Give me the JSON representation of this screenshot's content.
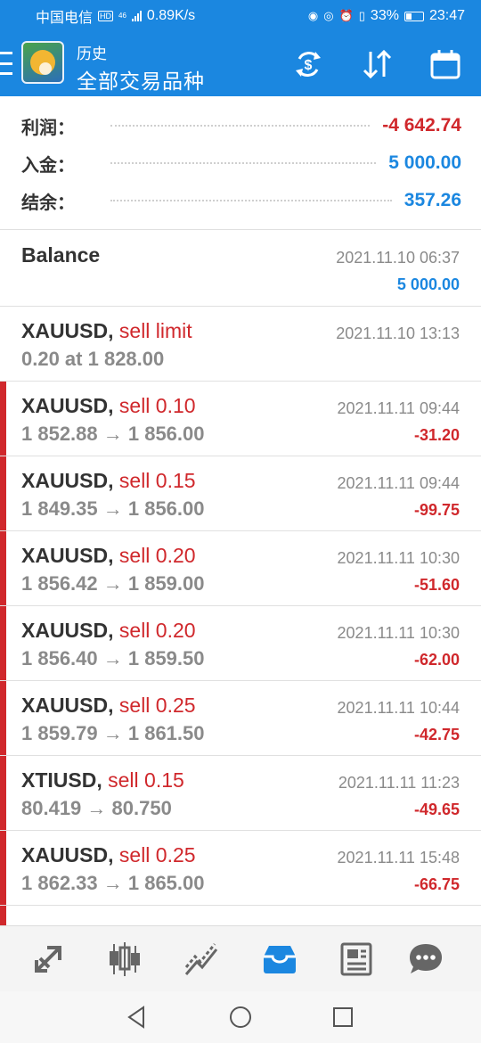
{
  "status_bar": {
    "carrier": "中国电信",
    "net_badge": "HD",
    "signal_label": "46",
    "speed": "0.89K/s",
    "battery": "33%",
    "time": "23:47"
  },
  "header": {
    "subtitle": "历史",
    "title": "全部交易品种",
    "icons": [
      "menu-icon",
      "app-logo",
      "currency-exchange-icon",
      "sort-icon",
      "calendar-icon"
    ]
  },
  "summary": {
    "profit_label": "利润：",
    "profit_value": "-4 642.74",
    "deposit_label": "入金：",
    "deposit_value": "5 000.00",
    "balance_label": "结余：",
    "balance_value": "357.26"
  },
  "colors": {
    "accent": "#1b87e0",
    "loss": "#d0282c",
    "muted": "#8a8a8a"
  },
  "balance_row": {
    "title": "Balance",
    "time": "2021.11.10 06:37",
    "amount": "5 000.00"
  },
  "order_row": {
    "symbol": "XAUUSD,",
    "action": "sell limit",
    "detail": "0.20 at 1 828.00",
    "time": "2021.11.10 13:13"
  },
  "trades": [
    {
      "symbol": "XAUUSD,",
      "action": "sell 0.10",
      "prices": "1 852.88 → 1 856.00",
      "time": "2021.11.11 09:44",
      "profit": "-31.20"
    },
    {
      "symbol": "XAUUSD,",
      "action": "sell 0.15",
      "prices": "1 849.35 → 1 856.00",
      "time": "2021.11.11 09:44",
      "profit": "-99.75"
    },
    {
      "symbol": "XAUUSD,",
      "action": "sell 0.20",
      "prices": "1 856.42 → 1 859.00",
      "time": "2021.11.11 10:30",
      "profit": "-51.60"
    },
    {
      "symbol": "XAUUSD,",
      "action": "sell 0.20",
      "prices": "1 856.40 → 1 859.50",
      "time": "2021.11.11 10:30",
      "profit": "-62.00"
    },
    {
      "symbol": "XAUUSD,",
      "action": "sell 0.25",
      "prices": "1 859.79 → 1 861.50",
      "time": "2021.11.11 10:44",
      "profit": "-42.75"
    },
    {
      "symbol": "XTIUSD,",
      "action": "sell 0.15",
      "prices": "80.419 → 80.750",
      "time": "2021.11.11 11:23",
      "profit": "-49.65"
    },
    {
      "symbol": "XAUUSD,",
      "action": "sell 0.25",
      "prices": "1 862.33 → 1 865.00",
      "time": "2021.11.11 15:48",
      "profit": "-66.75"
    }
  ],
  "bottom_tabs": [
    "quotes-icon",
    "chart-icon",
    "trade-icon",
    "history-icon",
    "news-icon",
    "chat-icon"
  ],
  "nav_bar": [
    "back-icon",
    "home-icon",
    "recents-icon"
  ]
}
